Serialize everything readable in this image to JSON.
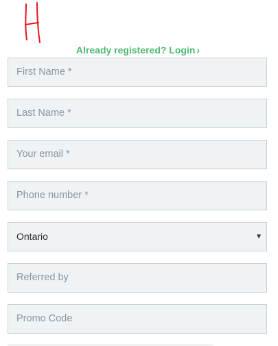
{
  "header": {
    "login_prompt": "Already registered? Login",
    "login_chevron": "›"
  },
  "form": {
    "first_name_placeholder": "First Name *",
    "last_name_placeholder": "Last Name *",
    "email_placeholder": "Your email *",
    "phone_placeholder": "Phone number *",
    "province_selected": "Ontario",
    "referred_by_placeholder": "Referred by",
    "promo_code_placeholder": "Promo Code"
  },
  "colors": {
    "login_link": "#4cb971",
    "field_background": "#eff3f6",
    "field_border": "#c8cdd0",
    "logo_stroke": "#e8141b"
  },
  "icons": {
    "logo": "handwritten-h-logo",
    "dropdown_arrow": "caret-down-icon"
  }
}
